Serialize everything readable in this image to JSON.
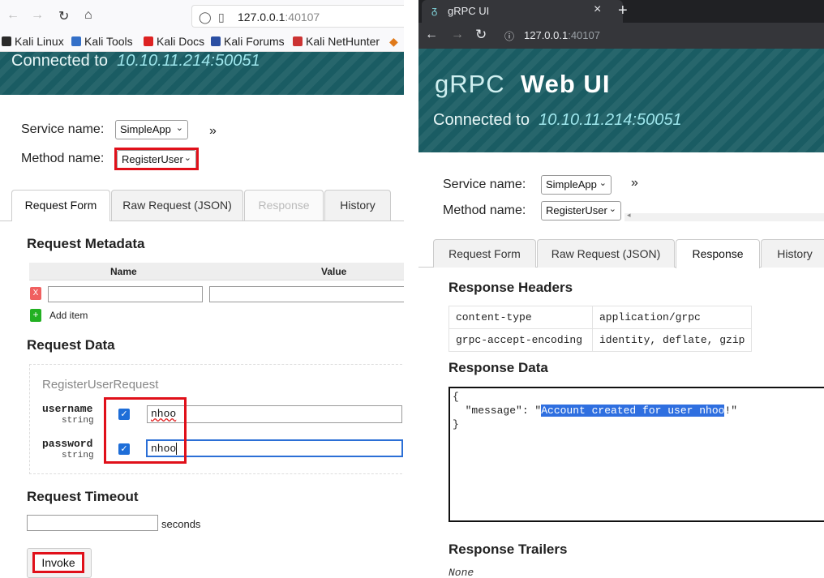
{
  "left": {
    "url_host": "127.0.0.1",
    "url_port": ":40107",
    "bookmarks": [
      "Kali Linux",
      "Kali Tools",
      "Kali Docs",
      "Kali Forums",
      "Kali NetHunter"
    ],
    "connected_label": "Connected to",
    "connected_addr": "10.10.11.214:50051",
    "service_label": "Service name:",
    "service_value": "SimpleApp",
    "method_label": "Method name:",
    "method_value": "RegisterUser",
    "more": "»",
    "tabs": [
      "Request Form",
      "Raw Request (JSON)",
      "Response",
      "History"
    ],
    "metadata_title": "Request Metadata",
    "meta_col_name": "Name",
    "meta_col_value": "Value",
    "remove_btn": "X",
    "add_btn": "+",
    "add_item": "Add item",
    "data_title": "Request Data",
    "message_type": "RegisterUserRequest",
    "fields": [
      {
        "name": "username",
        "type": "string",
        "value": "nhoo"
      },
      {
        "name": "password",
        "type": "string",
        "value": "nhoo"
      }
    ],
    "timeout_title": "Request Timeout",
    "seconds": "seconds",
    "invoke": "Invoke"
  },
  "right": {
    "tab_title": "gRPC UI",
    "tab_close": "×",
    "new_tab": "+",
    "url_host": "127.0.0.1",
    "url_port": ":40107",
    "logo": "gRPC",
    "title": "Web UI",
    "connected_label": "Connected to",
    "connected_addr": "10.10.11.214:50051",
    "service_label": "Service name:",
    "service_value": "SimpleApp",
    "method_label": "Method name:",
    "method_value": "RegisterUser",
    "more": "»",
    "tabs": [
      "Request Form",
      "Raw Request (JSON)",
      "Response",
      "History"
    ],
    "resp_headers_title": "Response Headers",
    "headers": [
      {
        "key": "content-type",
        "value": "application/grpc"
      },
      {
        "key": "grpc-accept-encoding",
        "value": "identity, deflate, gzip"
      }
    ],
    "resp_data_title": "Response Data",
    "resp_open": "{",
    "resp_key": "  \"message\": \"",
    "resp_highlight": "Account created for user nhoo",
    "resp_tail": "!\"",
    "resp_close": "}",
    "trailers_title": "Response Trailers",
    "trailers_value": "None"
  }
}
